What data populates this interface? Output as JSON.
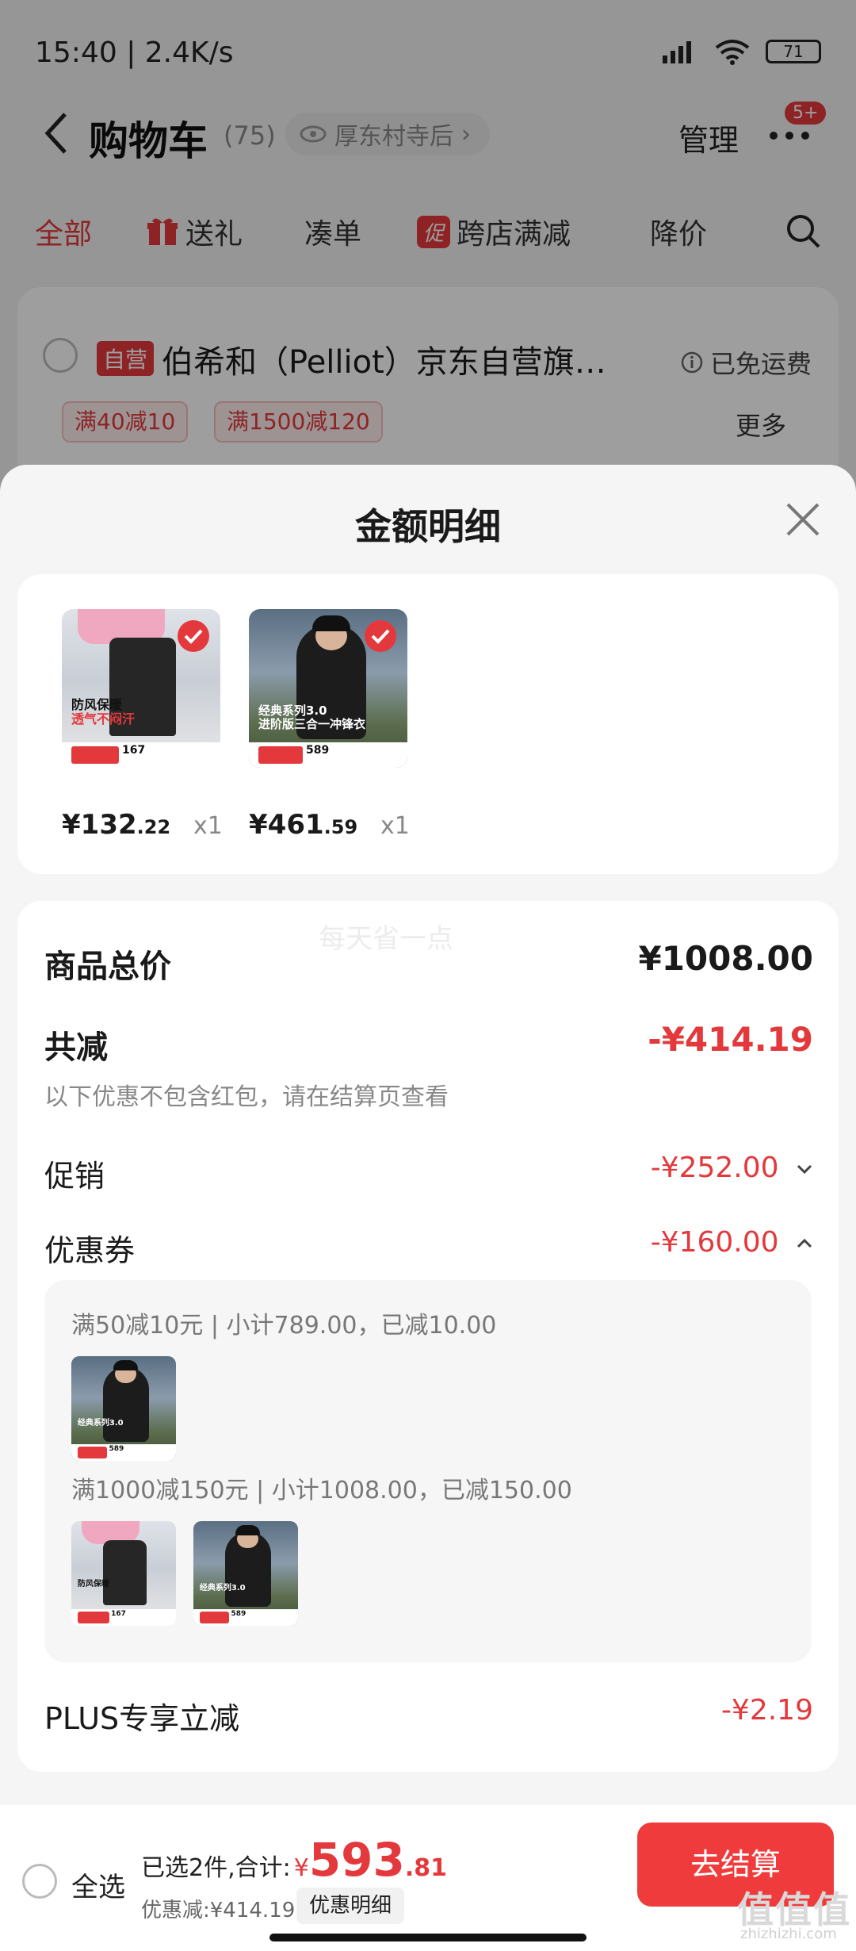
{
  "status_bar": {
    "time": "15:40 | 2.4K/s",
    "battery": "71"
  },
  "nav": {
    "title": "购物车",
    "count": "(75)",
    "location": "厚东村寺后",
    "manage": "管理",
    "badge": "5+"
  },
  "tabs": [
    {
      "label": "全部"
    },
    {
      "label": "送礼"
    },
    {
      "label": "凑单"
    },
    {
      "chip": "促",
      "label": "跨店满减"
    },
    {
      "label": "降价"
    }
  ],
  "store": {
    "self_tag": "自营",
    "name": "伯希和（Pelliot）京东自营旗…",
    "shipping": "已免运费",
    "promos": [
      "满40减10",
      "满1500减120"
    ],
    "more": "更多"
  },
  "sheet": {
    "title": "金额明细",
    "items": [
      {
        "price_int": "¥132",
        "price_dec": ".22",
        "qty": "x1",
        "image": "pelliot-pants",
        "thumb_text1": "防风保暖",
        "thumb_text2": "透气不闷汗",
        "thumb_price": "167"
      },
      {
        "price_int": "¥461",
        "price_dec": ".59",
        "qty": "x1",
        "image": "pelliot-jacket",
        "thumb_text1": "经典系列3.0",
        "thumb_text2": "进阶版三合一冲锋衣",
        "thumb_price": "589"
      }
    ],
    "watermark": "每天省一点",
    "total_label": "商品总价",
    "total_value": "¥1008.00",
    "discount_label": "共减",
    "discount_value": "-¥414.19",
    "discount_note": "以下优惠不包含红包，请在结算页查看",
    "promo_label": "促销",
    "promo_value": "-¥252.00",
    "coupon_label": "优惠券",
    "coupon_value": "-¥160.00",
    "coupons": [
      {
        "text": "满50减10元 | 小计789.00，已减10.00"
      },
      {
        "text": "满1000减150元 | 小计1008.00，已减150.00"
      }
    ],
    "plus_label": "PLUS专享立减",
    "plus_value": "-¥2.19"
  },
  "bottom": {
    "select_all": "全选",
    "selected_prefix": "已选2件,合计:",
    "currency": "¥",
    "sum_int": "593",
    "sum_dec": ".81",
    "saved": "优惠减:¥414.19",
    "detail_button": "优惠明细",
    "checkout": "去结算",
    "watermark": "值值值",
    "watermark_url": "zhizhizhi.com"
  },
  "colors": {
    "accent": "#e4393c",
    "checkout": "#ef3b3b"
  }
}
